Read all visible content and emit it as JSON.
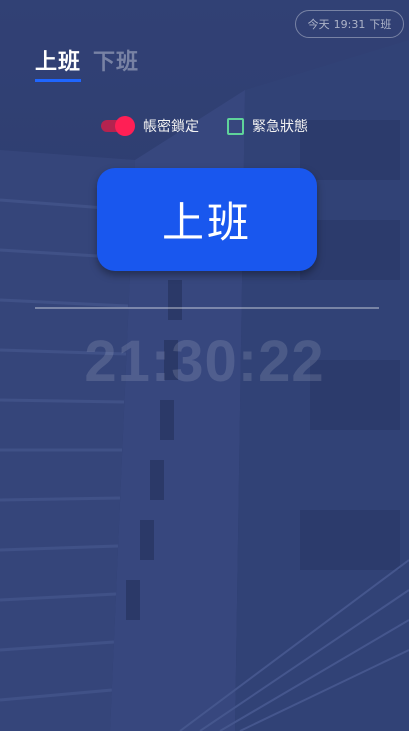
{
  "header": {
    "pill_day": "今天",
    "pill_time": "19:31",
    "pill_action": "下班"
  },
  "tabs": [
    {
      "label": "上班",
      "active": true
    },
    {
      "label": "下班",
      "active": false
    }
  ],
  "options": {
    "lock_account_label": "帳密鎖定",
    "lock_account_on": true,
    "emergency_label": "緊急狀態",
    "emergency_checked": false
  },
  "main_button": {
    "label": "上班"
  },
  "clock": {
    "time": "21:30:22"
  },
  "colors": {
    "accent": "#1957ee",
    "toggle": "#ff1f55",
    "checkbox": "#5fd39a"
  }
}
